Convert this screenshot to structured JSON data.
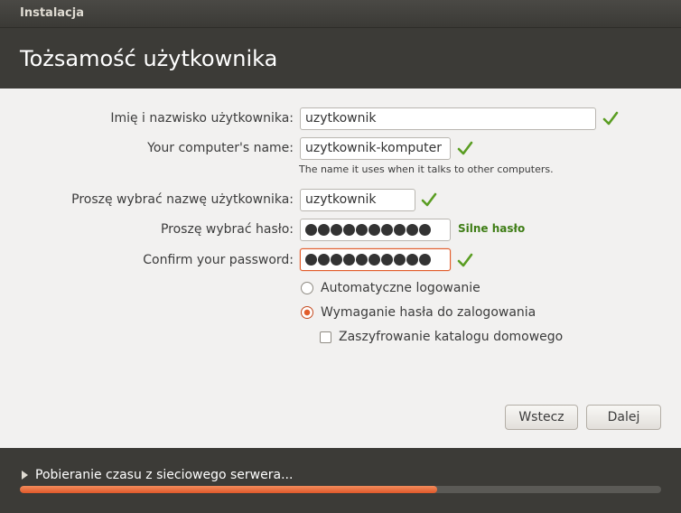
{
  "window": {
    "title": "Instalacja"
  },
  "page": {
    "title": "Tożsamość użytkownika"
  },
  "form": {
    "full_name": {
      "label": "Imię i nazwisko użytkownika:",
      "value": "uzytkownik"
    },
    "computer_name": {
      "label": "Your computer's name:",
      "value": "uzytkownik-komputer",
      "hint": "The name it uses when it talks to other computers."
    },
    "username": {
      "label": "Proszę wybrać nazwę użytkownika:",
      "value": "uzytkownik"
    },
    "password": {
      "label": "Proszę wybrać hasło:",
      "masked_length": 10,
      "strength": "Silne hasło"
    },
    "confirm": {
      "label": "Confirm your password:",
      "masked_length": 10
    },
    "login_options": [
      {
        "label": "Automatyczne logowanie",
        "selected": false
      },
      {
        "label": "Wymaganie hasła do zalogowania",
        "selected": true
      }
    ],
    "encrypt_home": {
      "label": "Zaszyfrowanie katalogu domowego",
      "checked": false
    }
  },
  "buttons": {
    "back": "Wstecz",
    "next": "Dalej"
  },
  "footer": {
    "status": "Pobieranie czasu z sieciowego serwera...",
    "progress": 0.65
  },
  "colors": {
    "accent": "#e25d2b",
    "check": "#5a9d22",
    "strength": "#3e7d15"
  }
}
